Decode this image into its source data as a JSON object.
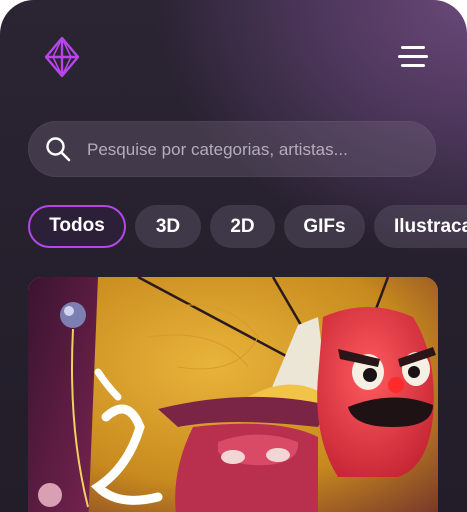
{
  "header": {
    "logo_icon": "diamond-logo-icon",
    "menu_icon": "hamburger-menu-icon"
  },
  "search": {
    "placeholder": "Pesquise por categorias, artistas..."
  },
  "categories": [
    {
      "label": "Todos",
      "active": true
    },
    {
      "label": "3D",
      "active": false
    },
    {
      "label": "2D",
      "active": false
    },
    {
      "label": "GIFs",
      "active": false
    },
    {
      "label": "Ilustraca",
      "active": false
    }
  ],
  "colors": {
    "accent": "#b547e8",
    "background": "#241e2b"
  }
}
